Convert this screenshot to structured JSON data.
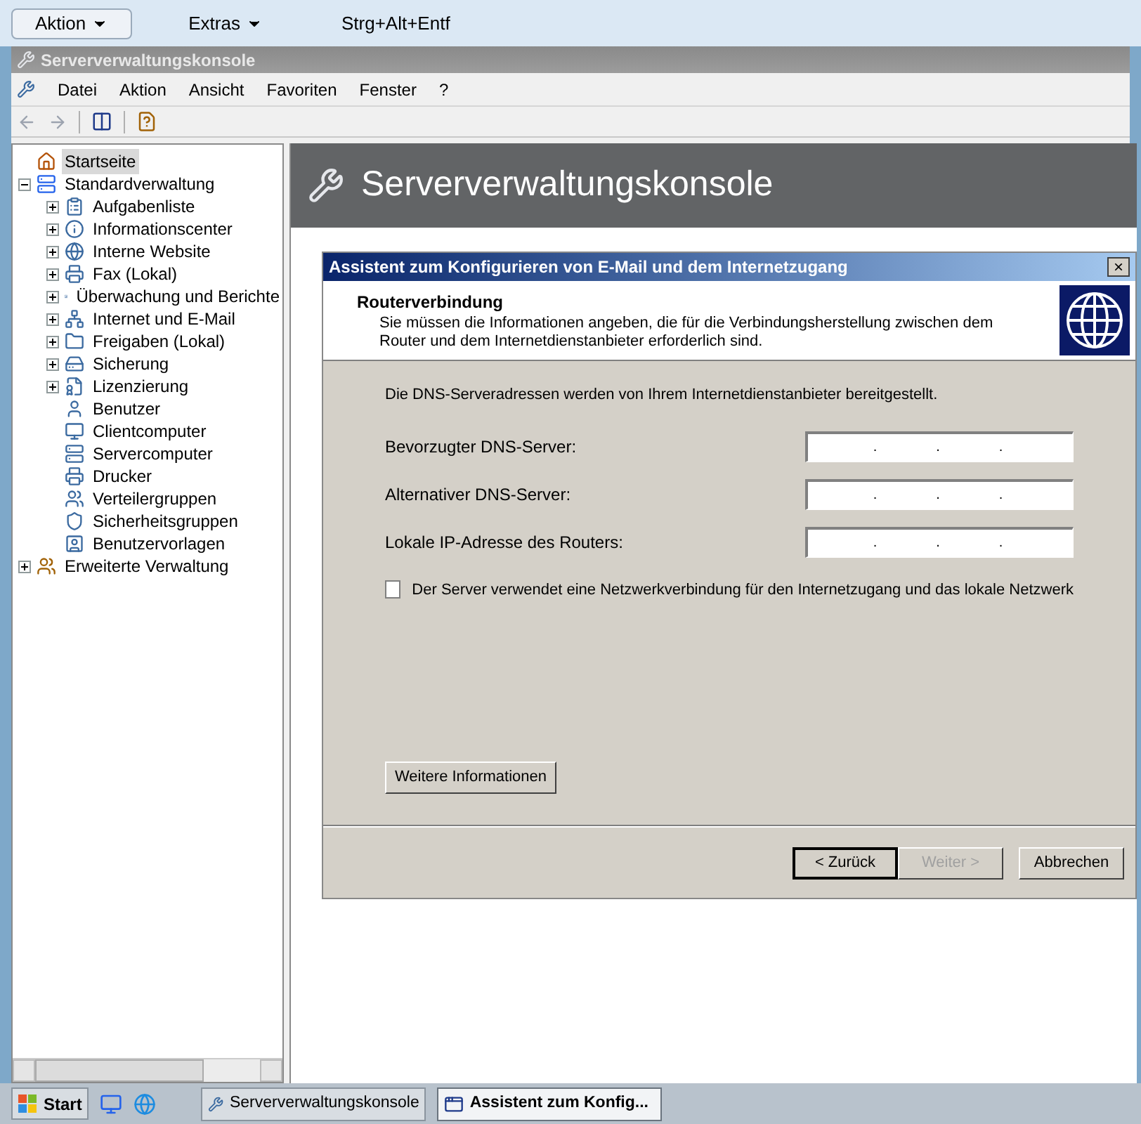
{
  "remote_bar": {
    "items": [
      {
        "label": "Aktion",
        "dropdown": true
      },
      {
        "label": "Extras",
        "dropdown": true
      },
      {
        "label": "Strg+Alt+Entf",
        "dropdown": false
      }
    ]
  },
  "window": {
    "title": "Serververwaltungskonsole"
  },
  "menu": [
    "Datei",
    "Aktion",
    "Ansicht",
    "Favoriten",
    "Fenster",
    "?"
  ],
  "tree": [
    {
      "label": "Startseite",
      "selected": true
    },
    {
      "label": "Standardverwaltung",
      "selected": false,
      "expanded": true,
      "children": [
        {
          "label": "Aufgabenliste",
          "selected": false,
          "expanded": false
        },
        {
          "label": "Informationscenter",
          "selected": false,
          "expanded": false
        },
        {
          "label": "Interne Website",
          "selected": false,
          "expanded": false
        },
        {
          "label": "Fax (Lokal)",
          "selected": false,
          "expanded": false
        },
        {
          "label": "Überwachung und Berichte",
          "selected": false,
          "expanded": false
        },
        {
          "label": "Internet und E-Mail",
          "selected": false,
          "expanded": false
        },
        {
          "label": "Freigaben (Lokal)",
          "selected": false,
          "expanded": false
        },
        {
          "label": "Sicherung",
          "selected": false,
          "expanded": false
        },
        {
          "label": "Lizenzierung",
          "selected": false,
          "expanded": false
        },
        {
          "label": "Benutzer",
          "selected": false
        },
        {
          "label": "Clientcomputer",
          "selected": false
        },
        {
          "label": "Servercomputer",
          "selected": false
        },
        {
          "label": "Drucker",
          "selected": false
        },
        {
          "label": "Verteilergruppen",
          "selected": false
        },
        {
          "label": "Sicherheitsgruppen",
          "selected": false
        },
        {
          "label": "Benutzervorlagen",
          "selected": false
        }
      ]
    },
    {
      "label": "Erweiterte Verwaltung",
      "selected": false,
      "expanded": false
    }
  ],
  "content_header": "Serververwaltungskonsole",
  "dialog": {
    "title": "Assistent zum Konfigurieren von E-Mail und dem Internetzugang",
    "close": "×",
    "heading": "Routerverbindung",
    "subheading": "Sie müssen die Informationen angeben, die für die Verbindungsherstellung zwischen dem Router und dem Internetdienstanbieter erforderlich sind.",
    "intro": "Die DNS-Serveradressen werden von Ihrem Internetdienstanbieter bereitgestellt.",
    "fields": [
      {
        "label": "Bevorzugter DNS-Server:",
        "separators": [
          ".",
          ".",
          "."
        ]
      },
      {
        "label": "Alternativer DNS-Server:",
        "separators": [
          ".",
          ".",
          "."
        ]
      },
      {
        "label": "Lokale IP-Adresse des Routers:",
        "separators": [
          ".",
          ".",
          "."
        ]
      }
    ],
    "checkbox": {
      "label": "Der Server verwendet eine Netzwerkverbindung für den Internetzugang und das lokale Netzwerk",
      "checked": false
    },
    "info_button": "Weitere Informationen",
    "buttons": [
      {
        "label": "< Zurück",
        "default": true,
        "disabled": false
      },
      {
        "label": "Weiter >",
        "default": false,
        "disabled": true
      },
      {
        "label": "Abbrechen",
        "default": false,
        "disabled": false
      }
    ]
  },
  "taskbar": {
    "start": "Start",
    "tasks": [
      {
        "label": "Serververwaltungskonsole",
        "selected": false
      },
      {
        "label": "Assistent zum Konfig...",
        "selected": true
      }
    ]
  }
}
